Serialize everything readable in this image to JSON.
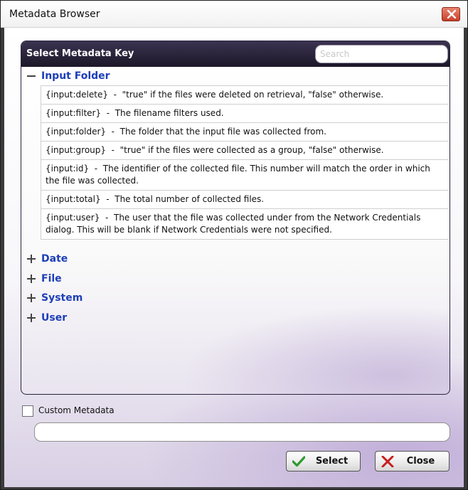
{
  "window": {
    "title": "Metadata Browser"
  },
  "panel": {
    "title": "Select Metadata Key",
    "search_placeholder": "Search"
  },
  "groups": [
    {
      "label": "Input Folder",
      "expanded": true,
      "items": [
        {
          "key": "{input:delete}",
          "desc": "\"true\" if the files were deleted on retrieval, \"false\" otherwise."
        },
        {
          "key": "{input:filter}",
          "desc": "The filename filters used."
        },
        {
          "key": "{input:folder}",
          "desc": "The folder that the input file was collected from."
        },
        {
          "key": "{input:group}",
          "desc": "\"true\" if the files were collected as a group, \"false\" otherwise."
        },
        {
          "key": "{input:id}",
          "desc": "The identifier of the collected file. This number will match the order in which the file was collected."
        },
        {
          "key": "{input:total}",
          "desc": "The total number of collected files."
        },
        {
          "key": "{input:user}",
          "desc": "The user that the file was collected under from the Network Credentials dialog. This will be blank if Network Credentials were not specified."
        }
      ]
    },
    {
      "label": "Date",
      "expanded": false
    },
    {
      "label": "File",
      "expanded": false
    },
    {
      "label": "System",
      "expanded": false
    },
    {
      "label": "User",
      "expanded": false
    }
  ],
  "item_separator": "-",
  "custom": {
    "label": "Custom Metadata",
    "checked": false,
    "value": ""
  },
  "buttons": {
    "select_label": "Select",
    "close_label": "Close"
  },
  "colors": {
    "header_dark": "#1c1728",
    "group_link": "#1d3fb8",
    "window_close": "#c7402a",
    "check_green": "#2e9a2e",
    "close_red": "#c81e1e"
  },
  "icons": {
    "window_close": "close-icon",
    "collapse": "minus-icon",
    "expand": "plus-icon",
    "select": "checkmark-icon",
    "close": "x-icon"
  }
}
